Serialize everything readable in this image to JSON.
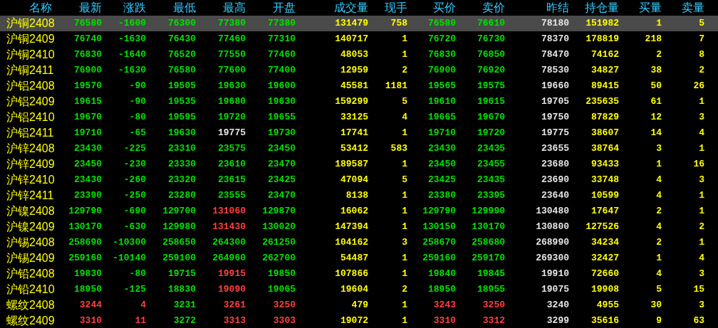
{
  "columns": [
    "名称",
    "最新",
    "涨跌",
    "最低",
    "最高",
    "开盘",
    "成交量",
    "现手",
    "买价",
    "卖价",
    "昨结",
    "持仓量",
    "买量",
    "卖量"
  ],
  "rows": [
    {
      "name": "沪铜2408",
      "selected": true,
      "cells": [
        "76580",
        "-1600",
        "76300",
        "77380",
        "77380",
        "131479",
        "758",
        "76580",
        "76610",
        "78180",
        "151982",
        "1",
        "5"
      ]
    },
    {
      "name": "沪铜2409",
      "selected": false,
      "cells": [
        "76740",
        "-1630",
        "76430",
        "77460",
        "77310",
        "140717",
        "1",
        "76720",
        "76730",
        "78370",
        "178819",
        "218",
        "7"
      ]
    },
    {
      "name": "沪铜2410",
      "selected": false,
      "cells": [
        "76830",
        "-1640",
        "76520",
        "77550",
        "77460",
        "48053",
        "1",
        "76830",
        "76850",
        "78470",
        "74162",
        "2",
        "8"
      ]
    },
    {
      "name": "沪铜2411",
      "selected": false,
      "cells": [
        "76900",
        "-1630",
        "76580",
        "77600",
        "77400",
        "12959",
        "2",
        "76900",
        "76920",
        "78530",
        "34827",
        "38",
        "2"
      ]
    },
    {
      "name": "沪铝2408",
      "selected": false,
      "cells": [
        "19570",
        "-90",
        "19505",
        "19630",
        "19600",
        "45581",
        "1181",
        "19565",
        "19575",
        "19660",
        "89415",
        "50",
        "26"
      ]
    },
    {
      "name": "沪铝2409",
      "selected": false,
      "cells": [
        "19615",
        "-90",
        "19535",
        "19680",
        "19630",
        "159299",
        "5",
        "19610",
        "19615",
        "19705",
        "235635",
        "61",
        "1"
      ]
    },
    {
      "name": "沪铝2410",
      "selected": false,
      "cells": [
        "19670",
        "-80",
        "19595",
        "19720",
        "19655",
        "33125",
        "4",
        "19665",
        "19670",
        "19750",
        "87829",
        "12",
        "3"
      ]
    },
    {
      "name": "沪铝2411",
      "selected": false,
      "cells": [
        "19710",
        "-65",
        "19630",
        "19775",
        "19730",
        "17741",
        "1",
        "19710",
        "19720",
        "19775",
        "38607",
        "14",
        "4"
      ]
    },
    {
      "name": "沪锌2408",
      "selected": false,
      "cells": [
        "23430",
        "-225",
        "23310",
        "23575",
        "23450",
        "53412",
        "583",
        "23430",
        "23435",
        "23655",
        "38764",
        "3",
        "1"
      ]
    },
    {
      "name": "沪锌2409",
      "selected": false,
      "cells": [
        "23450",
        "-230",
        "23330",
        "23610",
        "23470",
        "189587",
        "1",
        "23450",
        "23455",
        "23680",
        "93433",
        "1",
        "16"
      ]
    },
    {
      "name": "沪锌2410",
      "selected": false,
      "cells": [
        "23430",
        "-260",
        "23320",
        "23615",
        "23425",
        "47094",
        "5",
        "23425",
        "23435",
        "23690",
        "33748",
        "4",
        "3"
      ]
    },
    {
      "name": "沪锌2411",
      "selected": false,
      "cells": [
        "23390",
        "-250",
        "23280",
        "23555",
        "23470",
        "8138",
        "1",
        "23380",
        "23395",
        "23640",
        "10599",
        "4",
        "1"
      ]
    },
    {
      "name": "沪镍2408",
      "selected": false,
      "cells": [
        "129790",
        "-690",
        "129700",
        "131060",
        "129870",
        "16062",
        "1",
        "129790",
        "129990",
        "130480",
        "17647",
        "2",
        "1"
      ]
    },
    {
      "name": "沪镍2409",
      "selected": false,
      "cells": [
        "130170",
        "-630",
        "129980",
        "131430",
        "130020",
        "147394",
        "1",
        "130150",
        "130170",
        "130800",
        "127526",
        "4",
        "2"
      ]
    },
    {
      "name": "沪锡2408",
      "selected": false,
      "cells": [
        "258690",
        "-10300",
        "258650",
        "264300",
        "261250",
        "104162",
        "3",
        "258670",
        "258680",
        "268990",
        "34234",
        "2",
        "1"
      ]
    },
    {
      "name": "沪锡2409",
      "selected": false,
      "cells": [
        "259160",
        "-10140",
        "259100",
        "264960",
        "262700",
        "54487",
        "1",
        "259160",
        "259170",
        "269300",
        "32427",
        "1",
        "4"
      ]
    },
    {
      "name": "沪铅2408",
      "selected": false,
      "cells": [
        "19830",
        "-80",
        "19715",
        "19915",
        "19850",
        "107866",
        "1",
        "19840",
        "19845",
        "19910",
        "72660",
        "4",
        "3"
      ]
    },
    {
      "name": "沪铅2410",
      "selected": false,
      "cells": [
        "18950",
        "-125",
        "18830",
        "19090",
        "19065",
        "19604",
        "2",
        "18950",
        "18955",
        "19075",
        "19908",
        "5",
        "15"
      ]
    },
    {
      "name": "螺纹2408",
      "selected": false,
      "cells": [
        "3244",
        "4",
        "3231",
        "3261",
        "3250",
        "479",
        "1",
        "3243",
        "3250",
        "3240",
        "4955",
        "30",
        "3"
      ]
    },
    {
      "name": "螺纹2409",
      "selected": false,
      "cells": [
        "3310",
        "11",
        "3272",
        "3313",
        "3303",
        "19072",
        "1",
        "3310",
        "3312",
        "3299",
        "35616",
        "9",
        "63"
      ]
    }
  ]
}
